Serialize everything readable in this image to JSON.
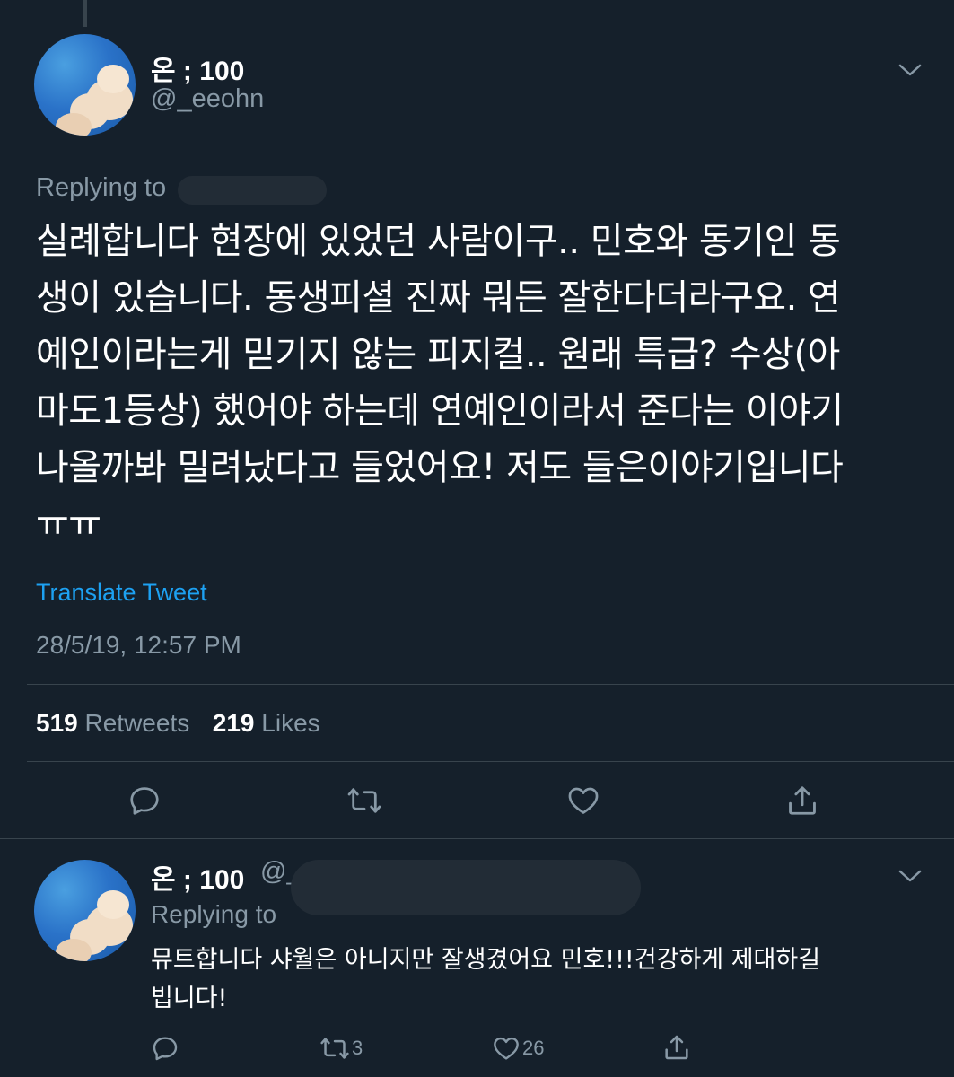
{
  "colors": {
    "background": "#15202b",
    "text": "#ffffff",
    "secondary_text": "#8899a6",
    "link": "#1da1f2",
    "divider": "#38444d"
  },
  "main_tweet": {
    "display_name": "온 ; 100",
    "handle": "@_eeohn",
    "replying_prefix": "Replying to",
    "text": "실례합니다 현장에 있었던 사람이구.. 민호와 동기인 동\n생이 있습니다. 동생피셜 진짜 뭐든 잘한다더라구요. 연\n예인이라는게 믿기지 않는 피지컬.. 원래 특급? 수상(아\n마도1등상) 했어야 하는데 연예인이라서 준다는 이야기\n나올까봐 밀려났다고 들었어요! 저도 들은이야기입니다\nㅠㅠ",
    "translate_label": "Translate Tweet",
    "timestamp": "28/5/19, 12:57 PM",
    "retweets_count": "519",
    "retweets_label": "Retweets",
    "likes_count": "219",
    "likes_label": "Likes",
    "actions": [
      "reply-icon",
      "retweet-icon",
      "like-icon",
      "share-icon"
    ]
  },
  "reply_tweet": {
    "display_name": "온 ; 100",
    "handle": "@_",
    "replying_prefix": "Replying to",
    "text": "뮤트합니다 샤월은 아니지만 잘생겼어요 민호!!!건강하게 제대하길\n빕니다!",
    "retweets_count": "3",
    "likes_count": "26",
    "actions": [
      "reply-icon",
      "retweet-icon",
      "like-icon",
      "share-icon"
    ]
  }
}
